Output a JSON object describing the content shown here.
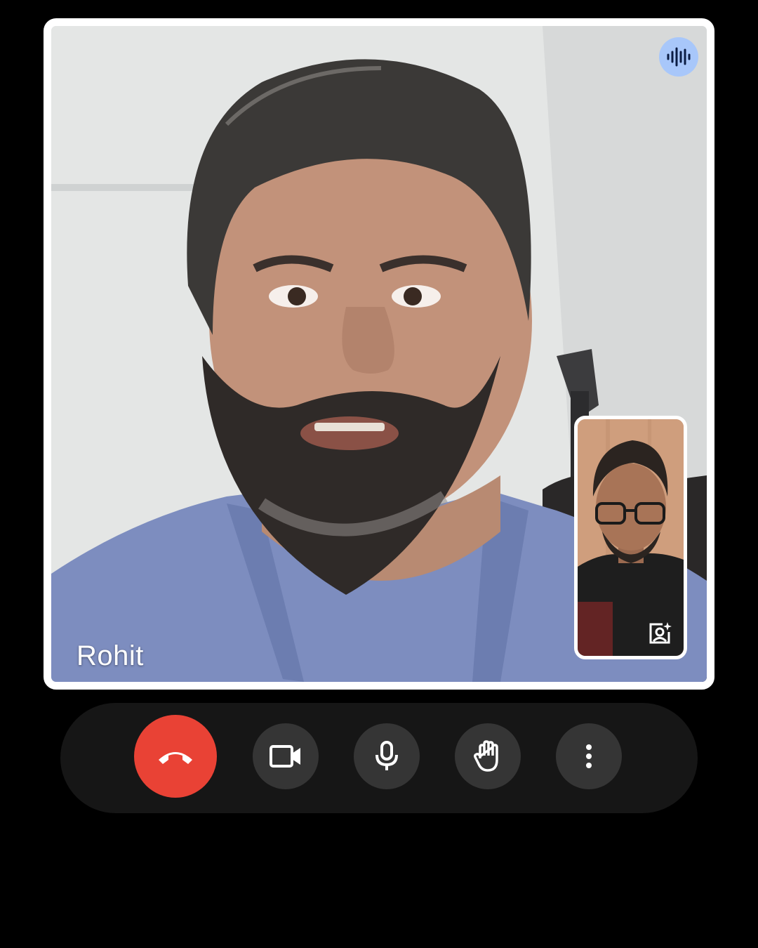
{
  "remote_participant": {
    "name": "Rohit"
  },
  "icons": {
    "speaking": "audio-wave-icon",
    "effects": "portrait-sparkle-icon",
    "end_call": "phone-hangup-icon",
    "camera": "videocam-icon",
    "microphone": "mic-icon",
    "raise_hand": "hand-icon",
    "more": "more-vert-icon"
  },
  "colors": {
    "background": "#000000",
    "tile_border": "#ffffff",
    "speaking_badge": "#a8c7fa",
    "control_bar": "#161616",
    "control_button": "#353535",
    "end_call": "#e94235"
  }
}
